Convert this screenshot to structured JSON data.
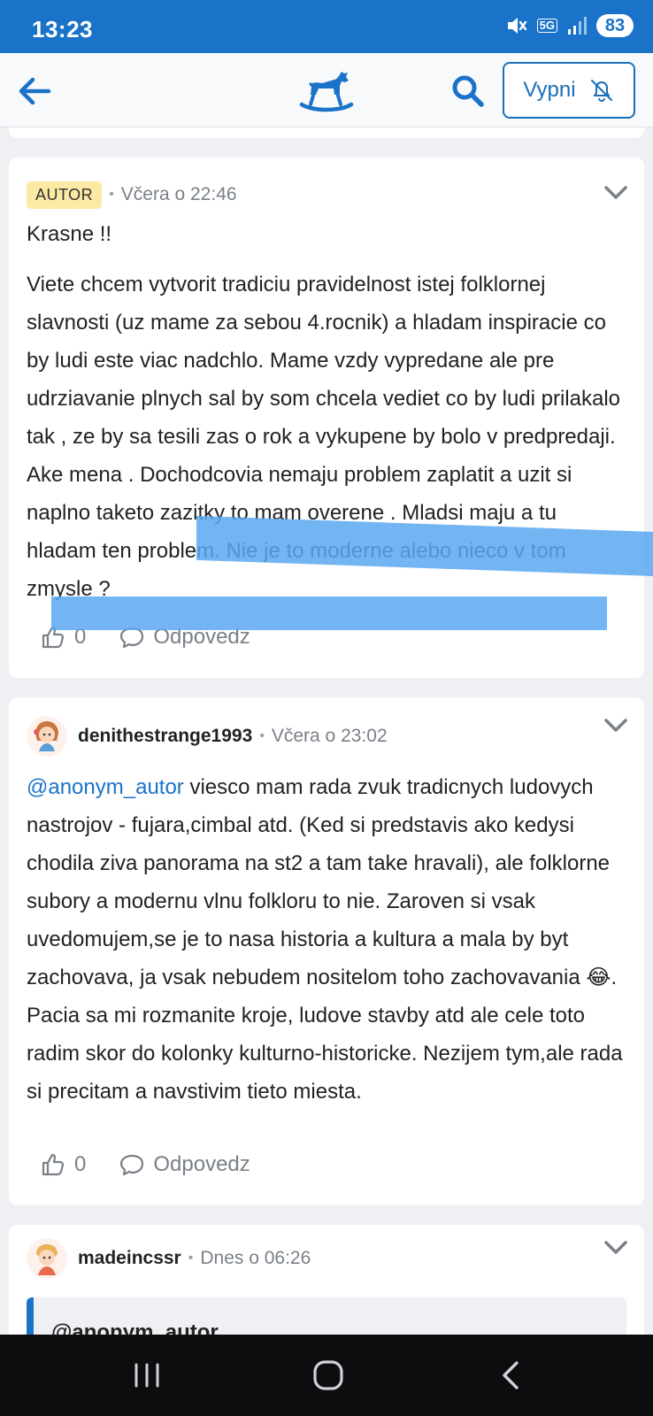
{
  "status_bar": {
    "time": "13:23",
    "network": "5G",
    "battery": "83"
  },
  "header": {
    "mute_label": "Vypni"
  },
  "comments": [
    {
      "badge": "AUTOR",
      "timestamp": "Včera o 22:46",
      "paragraph1": "Krasne !!",
      "paragraph2": "Viete chcem vytvorit tradiciu pravidelnost istej folklornej slavnosti (uz mame za sebou 4.rocnik) a hladam inspiracie co by ludi este viac nadchlo. Mame vzdy vypredane ale pre udrziavanie plnych sal by som chcela vediet co by ludi prilakalo tak , ze by sa tesili zas o rok a vykupene by bolo v predpredaji. Ake mena . Dochodcovia nemaju problem zaplatit a uzit si naplno taketo zazitky to mam overene . Mladsi maju a tu hladam ten problem. Nie je to moderne alebo nieco v tom zmysle ?",
      "likes": "0",
      "reply_label": "Odpovedz"
    },
    {
      "author": "denithestrange1993",
      "timestamp": "Včera o 23:02",
      "mention": "@anonym_autor",
      "text_before_emoji": " viesco mam rada zvuk tradicnych ludovych nastrojov - fujara,cimbal atd. (Ked si predstavis ako kedysi chodila ziva panorama na st2 a tam take hravali), ale folklorne subory a modernu vlnu folkloru to nie. Zaroven si vsak uvedomujem,se je to nasa historia a kultura a mala by byt zachovava, ja vsak nebudem nositelom toho zachovavania ",
      "emoji": "😂",
      "text_after_emoji": ". Pacia sa mi rozmanite kroje, ludove stavby atd ale cele toto radim skor do kolonky kulturno-historicke. Nezijem tym,ale rada si precitam a navstivim tieto miesta.",
      "likes": "0",
      "reply_label": "Odpovedz"
    },
    {
      "author": "madeincssr",
      "timestamp": "Dnes o 06:26",
      "quote": "@anonym_autor"
    }
  ]
}
